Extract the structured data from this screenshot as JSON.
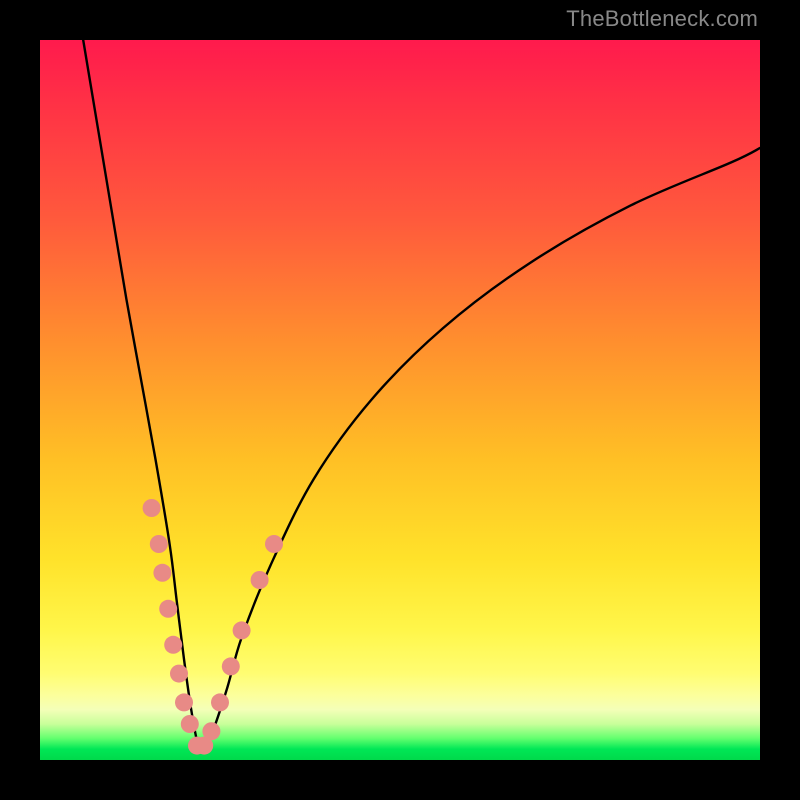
{
  "watermark": "TheBottleneck.com",
  "chart_data": {
    "type": "line",
    "title": "",
    "xlabel": "",
    "ylabel": "",
    "xlim": [
      0,
      100
    ],
    "ylim": [
      0,
      100
    ],
    "grid": false,
    "legend": false,
    "note": "V-shaped bottleneck curve; minimum near x≈22. Salmon markers cluster along both arms near the trough (roughly y 2–35).",
    "series": [
      {
        "name": "bottleneck-curve",
        "x": [
          6,
          8,
          10,
          12,
          14,
          16,
          18,
          19,
          20,
          21,
          22,
          23,
          24,
          26,
          28,
          32,
          38,
          46,
          56,
          68,
          82,
          96,
          100
        ],
        "y": [
          100,
          88,
          76,
          64,
          53,
          42,
          30,
          22,
          14,
          7,
          2,
          2,
          4,
          10,
          17,
          27,
          39,
          50,
          60,
          69,
          77,
          83,
          85
        ]
      }
    ],
    "markers": {
      "name": "sample-points",
      "points": [
        {
          "x": 15.5,
          "y": 35
        },
        {
          "x": 16.5,
          "y": 30
        },
        {
          "x": 17.0,
          "y": 26
        },
        {
          "x": 17.8,
          "y": 21
        },
        {
          "x": 18.5,
          "y": 16
        },
        {
          "x": 19.3,
          "y": 12
        },
        {
          "x": 20.0,
          "y": 8
        },
        {
          "x": 20.8,
          "y": 5
        },
        {
          "x": 21.8,
          "y": 2
        },
        {
          "x": 22.8,
          "y": 2
        },
        {
          "x": 23.8,
          "y": 4
        },
        {
          "x": 25.0,
          "y": 8
        },
        {
          "x": 26.5,
          "y": 13
        },
        {
          "x": 28.0,
          "y": 18
        },
        {
          "x": 30.5,
          "y": 25
        },
        {
          "x": 32.5,
          "y": 30
        }
      ]
    },
    "gradient_stops": [
      {
        "pos": 0.0,
        "color": "#ff1a4d"
      },
      {
        "pos": 0.25,
        "color": "#ff5a3c"
      },
      {
        "pos": 0.58,
        "color": "#ffbf25"
      },
      {
        "pos": 0.88,
        "color": "#fffd72"
      },
      {
        "pos": 0.97,
        "color": "#62ff6e"
      },
      {
        "pos": 1.0,
        "color": "#00d94a"
      }
    ]
  }
}
